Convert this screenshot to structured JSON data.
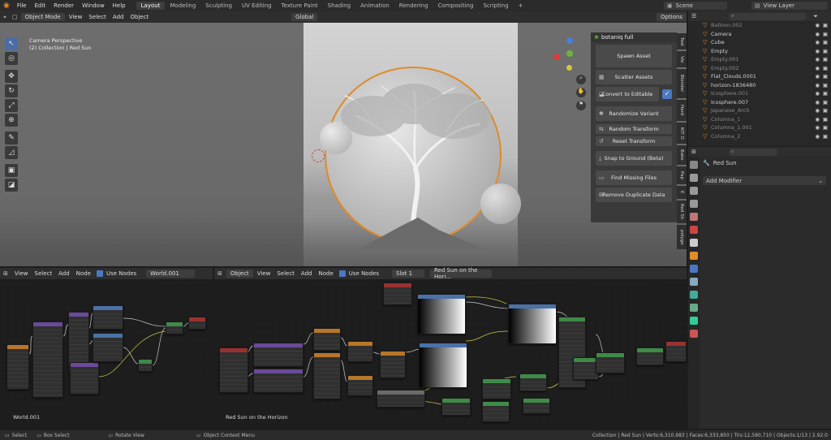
{
  "topbar": {
    "menus": [
      "File",
      "Edit",
      "Render",
      "Window",
      "Help"
    ],
    "workspaces": [
      "Layout",
      "Modeling",
      "Sculpting",
      "UV Editing",
      "Texture Paint",
      "Shading",
      "Animation",
      "Rendering",
      "Compositing",
      "Scripting"
    ],
    "active_workspace": "Layout",
    "scene": "Scene",
    "view_layer": "View Layer"
  },
  "viewport": {
    "mode": "Object Mode",
    "menus": [
      "View",
      "Select",
      "Add",
      "Object"
    ],
    "orientation": "Global",
    "options": "Options",
    "overlay_title": "Camera Perspective",
    "overlay_sub": "(2) Collection | Red Sun"
  },
  "botaniq": {
    "title": "botaniq full",
    "buttons": [
      "Spawn Asset",
      "Scatter Assets",
      "Convert to Editable",
      "Randomize Variant",
      "Random Transform",
      "Reset Transform",
      "Snap to Ground (Beta)",
      "Find Missing Files",
      "Remove Duplicate Data"
    ],
    "tabs": [
      "Tool",
      "Vie",
      "Blender",
      "Hard",
      "KIT O",
      "Bake",
      "Pap",
      "E",
      "Red Sh",
      "polygo"
    ]
  },
  "outliner": {
    "items": [
      {
        "name": "Balloon.002",
        "dim": true
      },
      {
        "name": "Camera",
        "dim": false
      },
      {
        "name": "Cube",
        "dim": false
      },
      {
        "name": "Empty",
        "dim": false
      },
      {
        "name": "Empty.001",
        "dim": true
      },
      {
        "name": "Empty.002",
        "dim": true
      },
      {
        "name": "Flat_Clouds.0001",
        "dim": false
      },
      {
        "name": "horizon-1836480",
        "dim": false
      },
      {
        "name": "Icosphere.001",
        "dim": true
      },
      {
        "name": "Icosphere.007",
        "dim": false
      },
      {
        "name": "Japanese_Arch",
        "dim": true
      },
      {
        "name": "Columna_1",
        "dim": true
      },
      {
        "name": "Columna_1.001",
        "dim": true
      },
      {
        "name": "Columna_2",
        "dim": true
      }
    ]
  },
  "properties": {
    "object_name": "Red Sun",
    "add_modifier": "Add Modifier"
  },
  "world_editor": {
    "menus": [
      "View",
      "Select",
      "Add",
      "Node"
    ],
    "use_nodes": "Use Nodes",
    "world": "World.001",
    "label": "World.001"
  },
  "shader_editor": {
    "object": "Object",
    "menus": [
      "View",
      "Select",
      "Add",
      "Node"
    ],
    "use_nodes": "Use Nodes",
    "slot": "Slot 1",
    "material": "Red Sun on the Hori...",
    "label": "Red Sun on the Horizon"
  },
  "statusbar": {
    "left": [
      "Select",
      "Box Select",
      "Rotate View",
      "Object Context Menu"
    ],
    "right": "Collection | Red Sun | Verts:6,310,983 | Faces:6,333,850 | Tris:12,580,710 | Objects:1/13 | 2.92.0"
  },
  "colors": {
    "accent": "#4a6da7",
    "sun_outline": "#e08a2a",
    "node_blue": "#4b72a8",
    "node_green": "#3f8a48",
    "node_red": "#9a3131",
    "node_purple": "#6a4a9a",
    "node_orange": "#b8762a"
  }
}
